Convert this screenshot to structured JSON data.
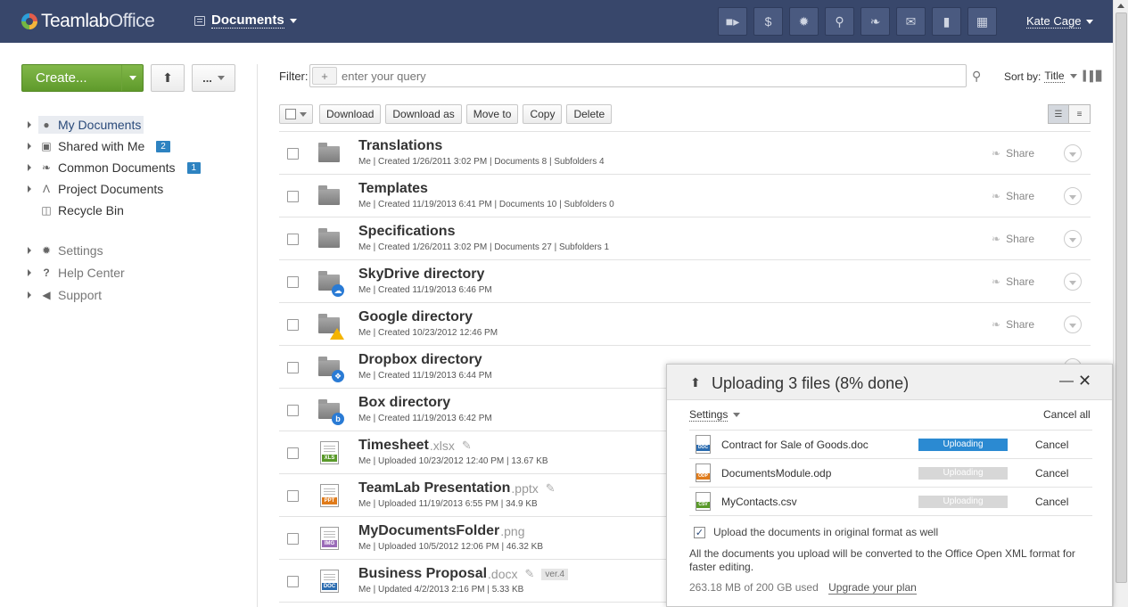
{
  "header": {
    "logo_bold": "Teamlab",
    "logo_light": "Office",
    "module": "Documents",
    "icons": [
      "video-icon",
      "dollar-icon",
      "settings-icon",
      "search-icon",
      "feed-icon",
      "mail-icon",
      "chat-icon",
      "calendar-icon"
    ],
    "user": "Kate Cage"
  },
  "sidebar": {
    "create_label": "Create...",
    "more_label": "...",
    "items": [
      {
        "label": "My Documents",
        "icon": "user-icon",
        "badge": "",
        "active": true
      },
      {
        "label": "Shared with Me",
        "icon": "briefcase-icon",
        "badge": "2"
      },
      {
        "label": "Common Documents",
        "icon": "feed-icon",
        "badge": "1"
      },
      {
        "label": "Project Documents",
        "icon": "compass-icon",
        "badge": ""
      },
      {
        "label": "Recycle Bin",
        "icon": "trash-icon",
        "badge": ""
      }
    ],
    "secondary": [
      {
        "label": "Settings",
        "icon": "gear-icon"
      },
      {
        "label": "Help Center",
        "icon": "question-icon"
      },
      {
        "label": "Support",
        "icon": "megaphone-icon"
      }
    ]
  },
  "filter": {
    "label": "Filter:",
    "placeholder": "enter your query",
    "sort_label": "Sort by:",
    "sort_value": "Title"
  },
  "toolbar": {
    "download": "Download",
    "download_as": "Download as",
    "move_to": "Move to",
    "copy": "Copy",
    "delete": "Delete"
  },
  "files": [
    {
      "name": "Translations",
      "ext": "",
      "meta": "Me | Created 1/26/2011 3:02 PM | Documents 8 | Subfolders 4",
      "kind": "folder",
      "share": "Share"
    },
    {
      "name": "Templates",
      "ext": "",
      "meta": "Me | Created 11/19/2013 6:41 PM | Documents 10 | Subfolders 0",
      "kind": "folder",
      "share": "Share"
    },
    {
      "name": "Specifications",
      "ext": "",
      "meta": "Me | Created 1/26/2011 3:02 PM | Documents 27 | Subfolders 1",
      "kind": "folder",
      "share": "Share"
    },
    {
      "name": "SkyDrive directory",
      "ext": "",
      "meta": "Me | Created 11/19/2013 6:46 PM",
      "kind": "folder-skydrive",
      "share": "Share"
    },
    {
      "name": "Google directory",
      "ext": "",
      "meta": "Me | Created 10/23/2012 12:46 PM",
      "kind": "folder-google",
      "share": "Share"
    },
    {
      "name": "Dropbox directory",
      "ext": "",
      "meta": "Me | Created 11/19/2013 6:44 PM",
      "kind": "folder-dropbox",
      "share": "Share"
    },
    {
      "name": "Box directory",
      "ext": "",
      "meta": "Me | Created 11/19/2013 6:42 PM",
      "kind": "folder-box",
      "share": ""
    },
    {
      "name": "Timesheet",
      "ext": ".xlsx",
      "meta": "Me | Uploaded 10/23/2012 12:40 PM | 13.67 KB",
      "kind": "xls",
      "share": ""
    },
    {
      "name": "TeamLab Presentation",
      "ext": ".pptx",
      "meta": "Me | Uploaded 11/19/2013 6:55 PM | 34.9 KB",
      "kind": "ppt",
      "share": ""
    },
    {
      "name": "MyDocumentsFolder",
      "ext": ".png",
      "meta": "Me | Uploaded 10/5/2012 12:06 PM | 46.32 KB",
      "kind": "img",
      "share": ""
    },
    {
      "name": "Business Proposal",
      "ext": ".docx",
      "meta": "Me | Updated 4/2/2013 2:16 PM | 5.33 KB",
      "kind": "doc",
      "share": "",
      "version": "ver.4"
    }
  ],
  "upload": {
    "title": "Uploading 3 files (8% done)",
    "settings": "Settings",
    "cancel_all": "Cancel all",
    "items": [
      {
        "name": "Contract for Sale of Goods.doc",
        "status": "Uploading",
        "progress": 1.0,
        "cancel": "Cancel",
        "type": "DOC",
        "color": "#2b6cb0"
      },
      {
        "name": "DocumentsModule.odp",
        "status": "Uploading",
        "progress": 0,
        "cancel": "Cancel",
        "type": "ODP",
        "color": "#e07b1a"
      },
      {
        "name": "MyContacts.csv",
        "status": "Uploading",
        "progress": 0,
        "cancel": "Cancel",
        "type": "CSV",
        "color": "#5a9a2a"
      }
    ],
    "original_format": "Upload the documents in original format as well",
    "note": "All the documents you upload will be converted to the Office Open XML format for faster editing.",
    "quota": "263.18 MB of 200 GB used",
    "upgrade": "Upgrade your plan"
  }
}
